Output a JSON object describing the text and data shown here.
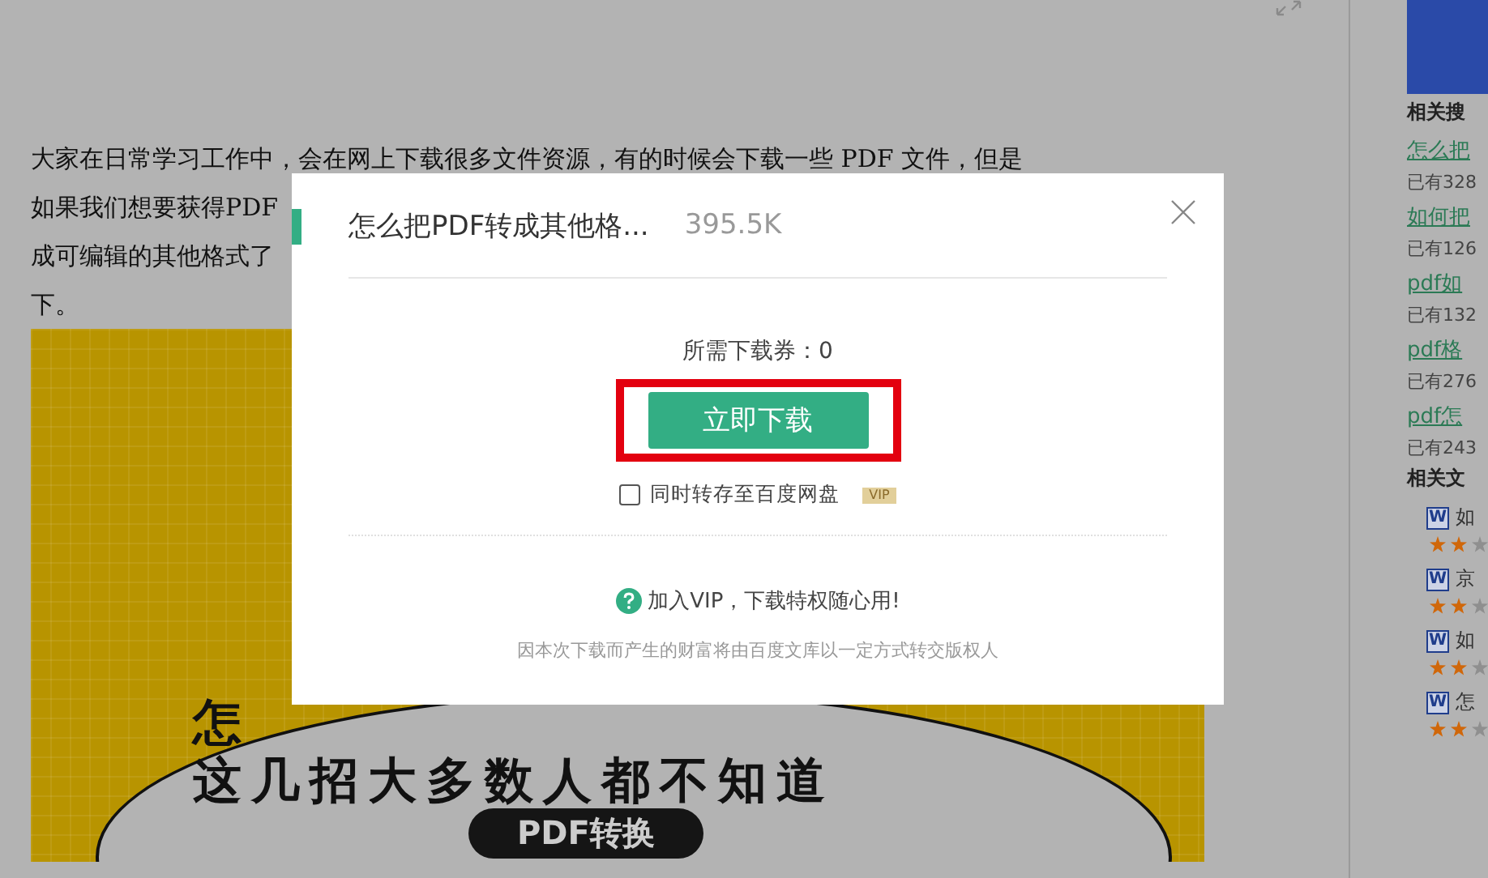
{
  "article": {
    "lines": [
      "大家在日常学习工作中，会在网上下载很多文件资源，有的时候会下载一些 PDF 文件，但是",
      "如果我们想要获得PDF",
      "成可编辑的其他格式了",
      "下。"
    ]
  },
  "poster": {
    "lines": [
      "怎",
      "这几招大多数人都不知道"
    ],
    "tag": "PDF转换"
  },
  "sidebar": {
    "search_heading": "相关搜",
    "searches": [
      {
        "link": "怎么把",
        "count": "已有328"
      },
      {
        "link": "如何把",
        "count": "已有126"
      },
      {
        "link": "pdf如",
        "count": "已有132"
      },
      {
        "link": "pdf格",
        "count": "已有276"
      },
      {
        "link": "pdf怎",
        "count": "已有243"
      }
    ],
    "docs_heading": "相关文",
    "docs": [
      {
        "icon": "W",
        "title": "如",
        "stars": 2
      },
      {
        "icon": "W",
        "title": "京",
        "stars": 2
      },
      {
        "icon": "W",
        "title": "如",
        "stars": 2
      },
      {
        "icon": "W",
        "title": "怎",
        "stars": 2
      }
    ]
  },
  "dialog": {
    "title": "怎么把PDF转成其他格...",
    "size": "395.5K",
    "cost": "所需下载券：0",
    "button": "立即下载",
    "save_option": {
      "label": "同时转存至百度网盘",
      "checked": false,
      "badge": "VIP"
    },
    "promo": "加入VIP，下载特权随心用!",
    "notice": "因本次下载而产生的财富将由百度文库以一定方式转交版权人"
  }
}
